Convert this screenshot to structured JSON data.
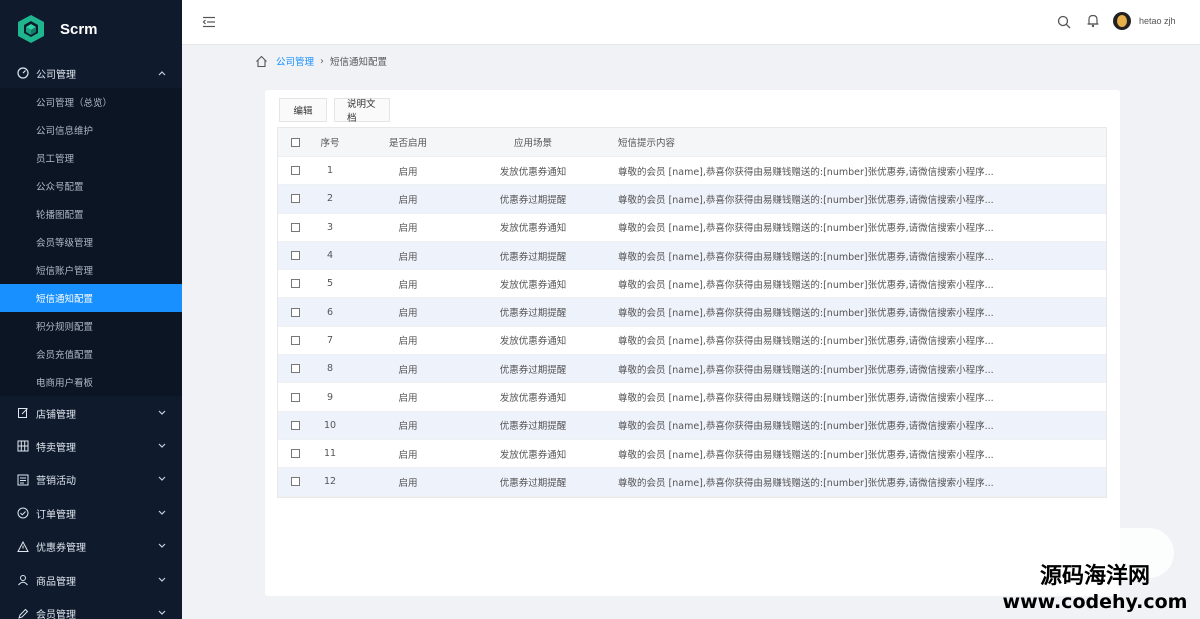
{
  "app": {
    "name": "Scrm",
    "brand_color": "#1890ff",
    "sidebar_bg": "#0f1b2d"
  },
  "sidebar": {
    "groups": [
      {
        "label": "公司管理",
        "icon": "dashboard-icon",
        "expanded": true
      },
      {
        "label": "店铺管理",
        "icon": "edit-icon",
        "expanded": false
      },
      {
        "label": "特卖管理",
        "icon": "grid-icon",
        "expanded": false
      },
      {
        "label": "营销活动",
        "icon": "list-icon",
        "expanded": false
      },
      {
        "label": "订单管理",
        "icon": "check-circle-icon",
        "expanded": false
      },
      {
        "label": "优惠券管理",
        "icon": "warning-icon",
        "expanded": false
      },
      {
        "label": "商品管理",
        "icon": "user-icon",
        "expanded": false
      },
      {
        "label": "会员管理",
        "icon": "pen-icon",
        "expanded": false
      }
    ],
    "company_items": [
      {
        "label": "公司管理（总览）"
      },
      {
        "label": "公司信息维护"
      },
      {
        "label": "员工管理"
      },
      {
        "label": "公众号配置"
      },
      {
        "label": "轮播图配置"
      },
      {
        "label": "会员等级管理"
      },
      {
        "label": "短信账户管理"
      },
      {
        "label": "短信通知配置",
        "active": true
      },
      {
        "label": "积分规则配置"
      },
      {
        "label": "会员充值配置"
      },
      {
        "label": "电商用户看板"
      }
    ]
  },
  "header": {
    "user_name": "hetao zjh"
  },
  "breadcrumb": {
    "parent": "公司管理",
    "current": "短信通知配置"
  },
  "toolbar": {
    "edit_label": "编辑",
    "docs_label": "说明文档"
  },
  "table": {
    "columns": [
      "序号",
      "是否启用",
      "应用场景",
      "短信提示内容"
    ],
    "rows": [
      {
        "no": "1",
        "enabled": "启用",
        "scene": "发放优惠券通知",
        "content": "尊敬的会员 [name],恭喜你获得由易赚钱赠送的:[number]张优惠券,请微信搜索小程序..."
      },
      {
        "no": "2",
        "enabled": "启用",
        "scene": "优惠券过期提醒",
        "content": "尊敬的会员 [name],恭喜你获得由易赚钱赠送的:[number]张优惠券,请微信搜索小程序..."
      },
      {
        "no": "3",
        "enabled": "启用",
        "scene": "发放优惠券通知",
        "content": "尊敬的会员 [name],恭喜你获得由易赚钱赠送的:[number]张优惠券,请微信搜索小程序..."
      },
      {
        "no": "4",
        "enabled": "启用",
        "scene": "优惠券过期提醒",
        "content": "尊敬的会员 [name],恭喜你获得由易赚钱赠送的:[number]张优惠券,请微信搜索小程序..."
      },
      {
        "no": "5",
        "enabled": "启用",
        "scene": "发放优惠券通知",
        "content": "尊敬的会员 [name],恭喜你获得由易赚钱赠送的:[number]张优惠券,请微信搜索小程序..."
      },
      {
        "no": "6",
        "enabled": "启用",
        "scene": "优惠券过期提醒",
        "content": "尊敬的会员 [name],恭喜你获得由易赚钱赠送的:[number]张优惠券,请微信搜索小程序..."
      },
      {
        "no": "7",
        "enabled": "启用",
        "scene": "发放优惠券通知",
        "content": "尊敬的会员 [name],恭喜你获得由易赚钱赠送的:[number]张优惠券,请微信搜索小程序..."
      },
      {
        "no": "8",
        "enabled": "启用",
        "scene": "优惠券过期提醒",
        "content": "尊敬的会员 [name],恭喜你获得由易赚钱赠送的:[number]张优惠券,请微信搜索小程序..."
      },
      {
        "no": "9",
        "enabled": "启用",
        "scene": "发放优惠券通知",
        "content": "尊敬的会员 [name],恭喜你获得由易赚钱赠送的:[number]张优惠券,请微信搜索小程序..."
      },
      {
        "no": "10",
        "enabled": "启用",
        "scene": "优惠券过期提醒",
        "content": "尊敬的会员 [name],恭喜你获得由易赚钱赠送的:[number]张优惠券,请微信搜索小程序..."
      },
      {
        "no": "11",
        "enabled": "启用",
        "scene": "发放优惠券通知",
        "content": "尊敬的会员 [name],恭喜你获得由易赚钱赠送的:[number]张优惠券,请微信搜索小程序..."
      },
      {
        "no": "12",
        "enabled": "启用",
        "scene": "优惠券过期提醒",
        "content": "尊敬的会员 [name],恭喜你获得由易赚钱赠送的:[number]张优惠券,请微信搜索小程序..."
      }
    ]
  },
  "watermark": {
    "line1": "源码海洋网",
    "line2": "www.codehy.com"
  }
}
